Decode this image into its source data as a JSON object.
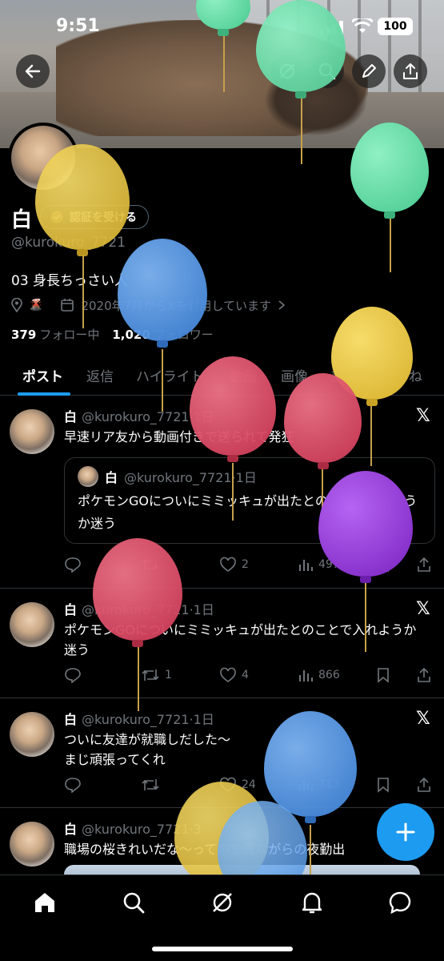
{
  "status_bar": {
    "time": "9:51",
    "battery": "100"
  },
  "profile": {
    "name": "白",
    "verify_label": "認証を受ける",
    "handle": "@kurokuro_7721",
    "bio": "03 身長ちっさい人",
    "location_icon": "🌋",
    "joined": "2020年7月からXを利用しています",
    "following_count": "379",
    "following_label": "フォロー中",
    "followers_count": "1,020",
    "followers_label": "フォロワー"
  },
  "tabs": [
    "ポスト",
    "返信",
    "ハイライト",
    "動画",
    "画像",
    "記事",
    "いいね"
  ],
  "posts": [
    {
      "name": "白",
      "meta": "@kurokuro_7721·1日",
      "text": "早速リア友から動画付きで送られて発狂",
      "quote": {
        "name": "白",
        "meta": "@kurokuro_7721·1日",
        "text": "ポケモンGOについにミミッキュが出たとのことで入れようか迷う"
      },
      "retweets": "",
      "likes": "2",
      "views": "497"
    },
    {
      "name": "白",
      "meta": "@kurokuro_7721·1日",
      "text": "ポケモンGOについにミミッキュが出たとのことで入れようか迷う",
      "retweets": "1",
      "likes": "4",
      "views": "866"
    },
    {
      "name": "白",
      "meta": "@kurokuro_7721·1日",
      "text": "ついに友達が就職しだした〜\nまじ頑張ってくれ",
      "retweets": "",
      "likes": "24",
      "views": "713"
    },
    {
      "name": "白",
      "meta": "@kurokuro_7721·3",
      "text": "職場の桜きれいだな〜ってのを見ながらの夜勤出"
    }
  ],
  "colors": {
    "accent": "#1d9bf0",
    "balloon_green": "#5fd3a0",
    "balloon_yellow": "#e6c53e",
    "balloon_blue": "#4a8fe0",
    "balloon_red": "#d9475f",
    "balloon_purple": "#8a2fd0"
  }
}
